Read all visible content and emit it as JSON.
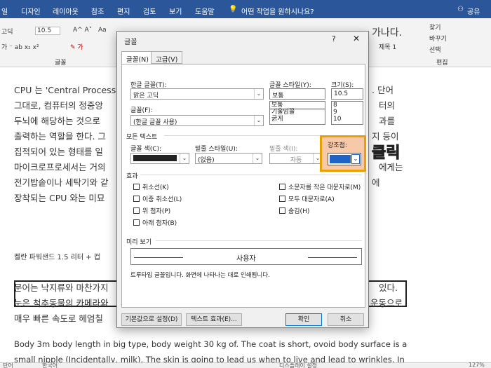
{
  "ribbon_tabs": [
    "일",
    "디자인",
    "레이아웃",
    "참조",
    "편지",
    "검토",
    "보기",
    "도움말"
  ],
  "tell_me": "어떤 작업을 원하시나요?",
  "share": "공유",
  "ribbon": {
    "font_name": "고딕",
    "font_size": "10.5",
    "style_preview": "가나다.",
    "style_name": "제목 1",
    "find": "찾기",
    "replace": "바꾸기",
    "select": "선택",
    "edit_group": "편집",
    "font_group": "글꼴"
  },
  "document": {
    "lines": [
      "CPU 는 'Central Processi",
      "그대로, 컴퓨터의 정중앙",
      "두뇌에 해당하는 것으로",
      "출력하는 역할을 한다. 그",
      "집적되어 있는 형태를 일",
      "마이크로프로세서는 거의",
      "전기밥솥이나 세탁기와 같",
      "장착되는 CPU 와는 미묘"
    ],
    "right_frags": [
      ". 단어",
      "터의",
      "과를",
      "지 등이",
      "",
      "에게는",
      "에",
      ""
    ],
    "caption": "켈란 파워샌드 1.5 리터 + 컵",
    "lines2": [
      "문어는 낙지류와 마찬가지",
      "눈은 척추동물의 카메라와",
      "매우 빠른 속도로 헤엄칠"
    ],
    "right2": [
      "있다.",
      "운동으로",
      ""
    ],
    "english1": "Body 3m body length in big type, body weight 30  kg  of. The coat is short, ovoid body surface is a",
    "english2": "small nipple (Incidentally, milk). The skin is going to lead us when to live and lead to wrinkles. In"
  },
  "status": {
    "page": "단어",
    "lang": "한국어",
    "mode": "디스플레이 설정",
    "zoom": "127%"
  },
  "dialog": {
    "title": "글꼴",
    "help": "?",
    "close": "✕",
    "tabs": [
      "글꼴(N)",
      "고급(V)"
    ],
    "korean_font_label": "한글 글꼴(T):",
    "korean_font_value": "맑은 고딕",
    "font_label": "글꼴(F):",
    "font_value": "(한글 글꼴 사용)",
    "style_label": "글꼴 스타일(Y):",
    "style_value": "보통",
    "style_options": [
      "보통",
      "기울임꼴",
      "굵게"
    ],
    "size_label": "크기(S):",
    "size_value": "10.5",
    "size_options": [
      "8",
      "9",
      "10"
    ],
    "all_text": "모든 텍스트",
    "color_label": "글꼴 색(C):",
    "underline_label": "밑줄 스타일(U):",
    "underline_value": "(없음)",
    "underline_color_label": "밑줄 색(I):",
    "underline_color_value": "자동",
    "emphasis_label": "강조점:",
    "effects": "효과",
    "checks_left": [
      "취소선(K)",
      "이중 취소선(L)",
      "위 첨자(P)",
      "아래 첨자(B)"
    ],
    "checks_right": [
      "소문자를 작은 대문자로(M)",
      "모두 대문자로(A)",
      "숨김(H)"
    ],
    "preview_label": "미리 보기",
    "preview_text": "사용자",
    "note": "트루타입 글꼴입니다. 화면에 나타나는 대로 인쇄됩니다.",
    "btn_default": "기본값으로 설정(D)",
    "btn_effects": "텍스트 효과(E)...",
    "btn_ok": "확인",
    "btn_cancel": "취소"
  },
  "annotation": "클릭",
  "colors": {
    "accent": "#2b579a",
    "highlight": "#e8a000",
    "emphasis_swatch": "#1f63c6"
  }
}
